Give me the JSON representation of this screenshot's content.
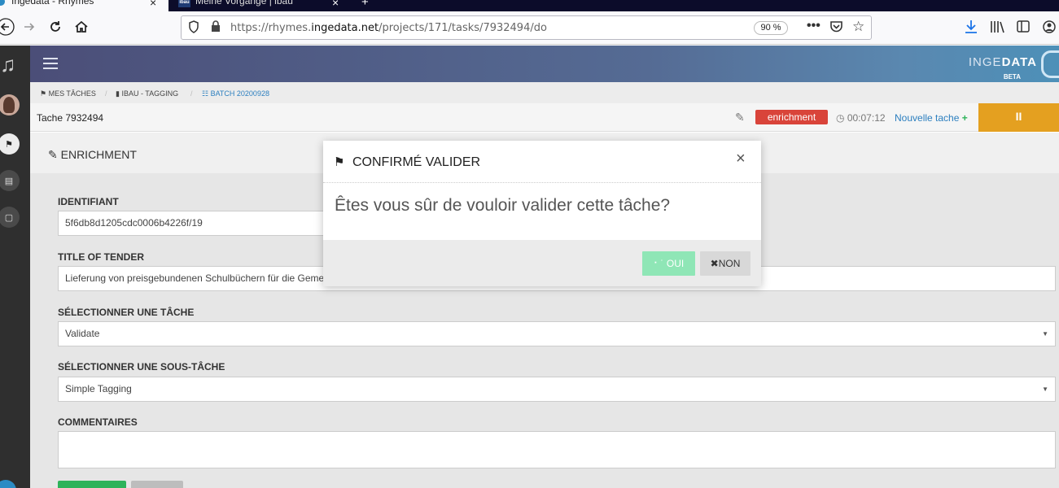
{
  "browser": {
    "tabs": [
      {
        "title": "Ingedata - Rhymes",
        "active": true
      },
      {
        "title": "Meine Vorgänge | ibau",
        "active": false
      }
    ],
    "tab_close_glyph": "×",
    "new_tab_glyph": "+",
    "url_prefix": "https://rhymes.",
    "url_domain": "ingedata.net",
    "url_path": "/projects/171/tasks/7932494/do",
    "zoom": "90 %",
    "icons": [
      "back-icon",
      "forward-icon",
      "reload-icon",
      "home-icon",
      "shield-icon",
      "lock-icon",
      "more-icon",
      "pocket-icon",
      "star-icon",
      "download-icon",
      "library-icon",
      "sidebar-icon",
      "account-icon"
    ]
  },
  "app": {
    "brand_light": "INGE",
    "brand_bold": "DATA",
    "brand_beta": "BETA",
    "breadcrumb": [
      {
        "label": "MES TÂCHES"
      },
      {
        "label": "IBAU - TAGGING"
      },
      {
        "label": "BATCH 20200928"
      }
    ],
    "task": {
      "title": "Tache 7932494",
      "badge": "enrichment",
      "timer": "00:07:12",
      "new_task": "Nouvelle tache",
      "pause_glyph": "II",
      "accent": "#e4a020",
      "badge_color": "#d9443a"
    },
    "panel_title": "ENRICHMENT",
    "fields": [
      {
        "label": "IDENTIFIANT",
        "value": "5f6db8d1205cdc0006b4226f/19"
      },
      {
        "label": "TITLE OF TENDER",
        "value": "Lieferung von preisgebundenen Schulbüchern für die Gemeinde"
      },
      {
        "label": "SÉLECTIONNER UNE TÂCHE",
        "value": "Validate"
      },
      {
        "label": "SÉLECTIONNER UNE SOUS-TÂCHE",
        "value": "Simple Tagging"
      },
      {
        "label": "COMMENTAIRES",
        "value": ""
      }
    ]
  },
  "modal": {
    "title": "CONFIRMÉ VALIDER",
    "body": "Êtes vous sûr de vouloir valider cette tâche?",
    "close_glyph": "×",
    "confirm_label": "OUI",
    "cancel_label": "NON",
    "confirm_color": "#8fe6b6"
  }
}
